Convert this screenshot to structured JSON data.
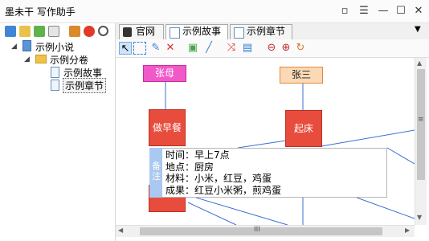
{
  "app": {
    "title": "墨未干 写作助手"
  },
  "window_controls": {
    "restore": "▫",
    "menu": "☰",
    "minimize": "—",
    "maximize": "☐",
    "close": "✕"
  },
  "tree": {
    "root": "示例小说",
    "volume": "示例分卷",
    "items": [
      "示例故事",
      "示例章节"
    ],
    "selected": "示例章节"
  },
  "tabs": [
    {
      "label": "官网",
      "icon": "website-icon"
    },
    {
      "label": "示例故事",
      "icon": "story-icon",
      "active": true
    },
    {
      "label": "示例章节",
      "icon": "chapter-icon"
    }
  ],
  "tab_dropdown": "▼",
  "canvas": {
    "nodes": [
      {
        "label": "张母",
        "color": "#f259c8"
      },
      {
        "label": "张三",
        "color": "#f5a36a"
      },
      {
        "label": "做早餐",
        "color": "#e84c3d"
      },
      {
        "label": "起床",
        "color": "#e84c3d"
      }
    ],
    "note": {
      "side_label": "备注",
      "lines": [
        "时间：早上7点",
        "地点：厨房",
        "材料：小米，红豆，鸡蛋",
        "成果：红豆小米粥，煎鸡蛋"
      ]
    }
  },
  "scrollbar": {
    "h_grip": "III",
    "v_grip": "≡"
  },
  "colors": {
    "accent_blue": "#3b7dd8",
    "link_line": "#3b6fd4",
    "node_red": "#e84c3d"
  }
}
